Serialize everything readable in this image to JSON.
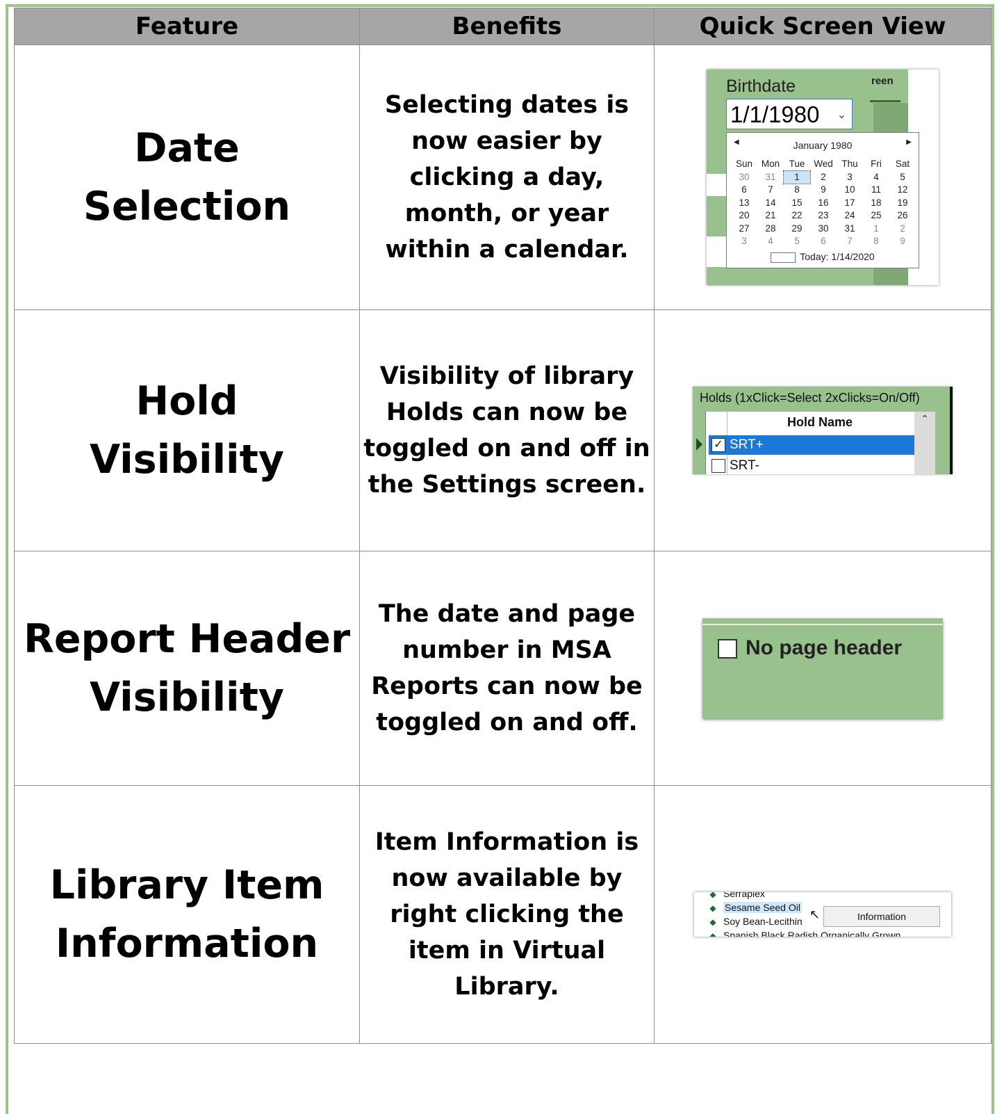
{
  "table": {
    "headers": [
      "Feature",
      "Benefits",
      "Quick Screen View"
    ],
    "rows": [
      {
        "feature_line1": "Date",
        "feature_line2": "Selection",
        "benefit": "Selecting dates is now easier by clicking a day, month, or year within a calendar."
      },
      {
        "feature_line1": "Hold",
        "feature_line2": "Visibility",
        "benefit": "Visibility of library Holds can now be toggled on and off in the Settings screen."
      },
      {
        "feature_line1": "Report Header",
        "feature_line2": "Visibility",
        "benefit": "The date and page number in MSA Reports can now be toggled on and off."
      },
      {
        "feature_line1": "Library Item",
        "feature_line2": "Information",
        "benefit": "Item Information is now available by right clicking the item in Virtual Library."
      }
    ]
  },
  "datepicker": {
    "label": "Birthdate",
    "value": "1/1/1980",
    "partial_word": "reen",
    "month_title": "January 1980",
    "weekdays": [
      "Sun",
      "Mon",
      "Tue",
      "Wed",
      "Thu",
      "Fri",
      "Sat"
    ],
    "weeks": [
      [
        "30",
        "31",
        "1",
        "2",
        "3",
        "4",
        "5"
      ],
      [
        "6",
        "7",
        "8",
        "9",
        "10",
        "11",
        "12"
      ],
      [
        "13",
        "14",
        "15",
        "16",
        "17",
        "18",
        "19"
      ],
      [
        "20",
        "21",
        "22",
        "23",
        "24",
        "25",
        "26"
      ],
      [
        "27",
        "28",
        "29",
        "30",
        "31",
        "1",
        "2"
      ],
      [
        "3",
        "4",
        "5",
        "6",
        "7",
        "8",
        "9"
      ]
    ],
    "today_label": "Today: 1/14/2020"
  },
  "holds": {
    "title": "Holds (1xClick=Select  2xClicks=On/Off)",
    "column_header": "Hold Name",
    "items": [
      {
        "name": "SRT+",
        "checked": true
      },
      {
        "name": "SRT-",
        "checked": false
      }
    ]
  },
  "report": {
    "checkbox_label": "No page header"
  },
  "library": {
    "items": [
      "Serraplex",
      "Sesame Seed Oil",
      "Soy Bean-Lecithin",
      "Spanish Black Radish Organically Grown"
    ],
    "menu_item": "Information"
  }
}
